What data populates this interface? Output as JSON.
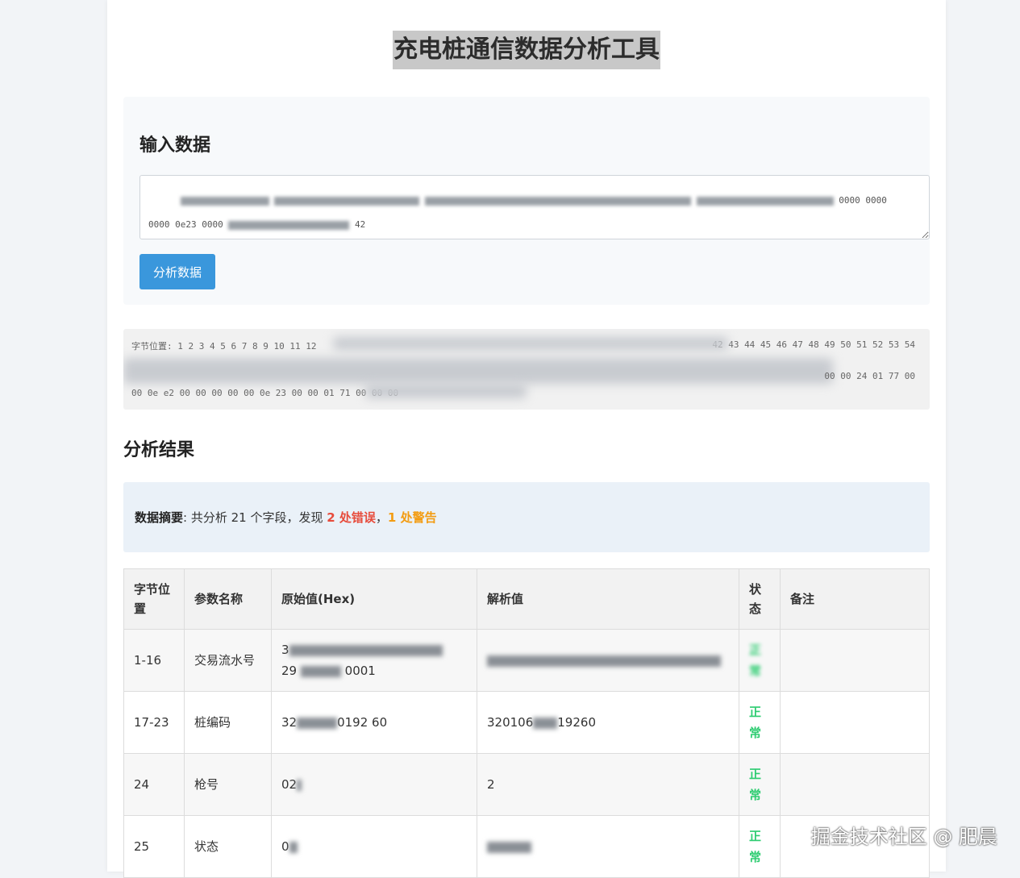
{
  "page": {
    "title": "充电桩通信数据分析工具"
  },
  "input_section": {
    "heading": "输入数据",
    "textarea_visible_line1_end": "0000 0000",
    "textarea_visible_line2_start": "0000 0e23 0000",
    "textarea_visible_line2_end": "42",
    "analyze_button": "分析数据"
  },
  "byte_panel": {
    "label": "字节位置:",
    "positions_start": "1 2 3 4 5 6 7 8 9 10 11 12",
    "positions_end": "42 43 44 45 46 47 48 49 50 51 52 53 54",
    "row2_end": "00 00 24 01 77 00",
    "row3_start": "00 0e e2 00 00 00 00 00 0e 23 00 00 01 71 00 00 00"
  },
  "results": {
    "heading": "分析结果",
    "summary": {
      "label": "数据摘要",
      "text_pre": ": 共分析 21 个字段，发现 ",
      "errors": "2 处错误",
      "sep": "，",
      "warnings": "1 处警告"
    },
    "table": {
      "headers": [
        "字节位置",
        "参数名称",
        "原始值(Hex)",
        "解析值",
        "状态",
        "备注"
      ],
      "rows": [
        {
          "pos": "1-16",
          "name": "交易流水号",
          "raw_start": "3",
          "raw_line2": "29",
          "raw_line2_end": "0001",
          "parsed": "",
          "status": "正常",
          "note": ""
        },
        {
          "pos": "17-23",
          "name": "桩编码",
          "raw_start": "32",
          "raw_end": "0192 60",
          "parsed_start": "320106",
          "parsed_end": "19260",
          "status": "正常",
          "note": ""
        },
        {
          "pos": "24",
          "name": "枪号",
          "raw_start": "02",
          "parsed": "2",
          "status": "正常",
          "note": ""
        },
        {
          "pos": "25",
          "name": "状态",
          "raw_start": "0",
          "parsed": "",
          "status": "正常",
          "note": ""
        }
      ]
    }
  },
  "watermark": "掘金技术社区 @ 肥晨",
  "colors": {
    "button": "#3a97dc",
    "error": "#e74c3c",
    "warning": "#f39c12",
    "ok": "#2ecc71",
    "summary_bg": "#eaf1f8"
  }
}
